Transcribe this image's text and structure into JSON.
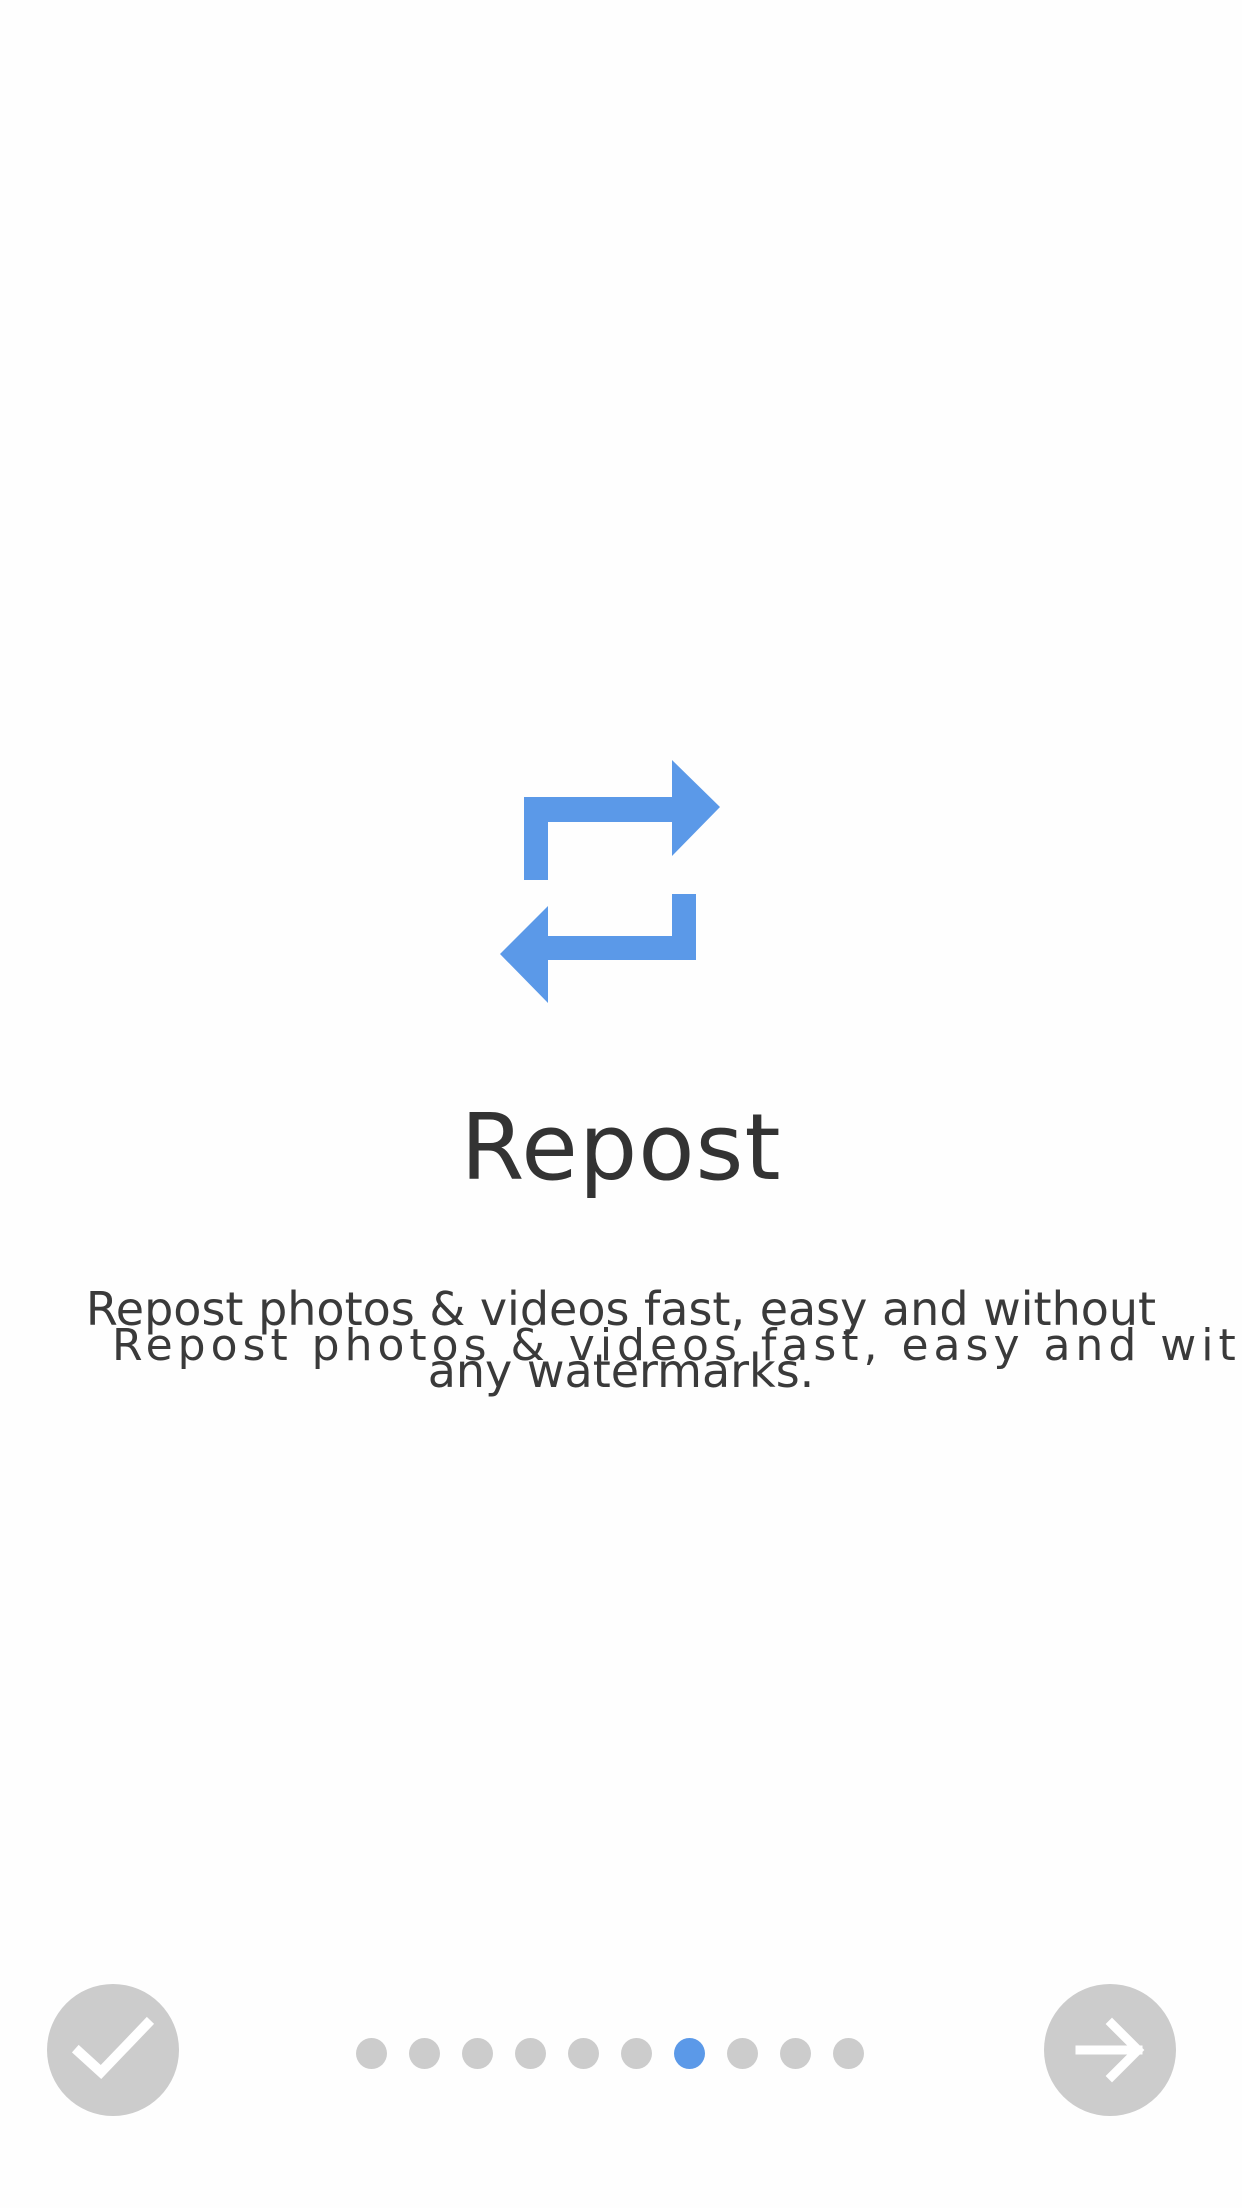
{
  "onboarding": {
    "title": "Repost",
    "description_line1": "Repost photos & videos fast, easy and without",
    "description_line2": "any watermarks.",
    "description_overlay": "Repost photos & videos fast, easy and withou",
    "icon": "repost-icon",
    "accent_color": "#5b99e8"
  },
  "pager": {
    "total_pages": 10,
    "active_index": 6,
    "dot_color": "#cccccc",
    "active_dot_color": "#5b99e8"
  },
  "buttons": {
    "done_icon": "checkmark-icon",
    "next_icon": "arrow-right-icon",
    "button_color": "#cccccc"
  }
}
